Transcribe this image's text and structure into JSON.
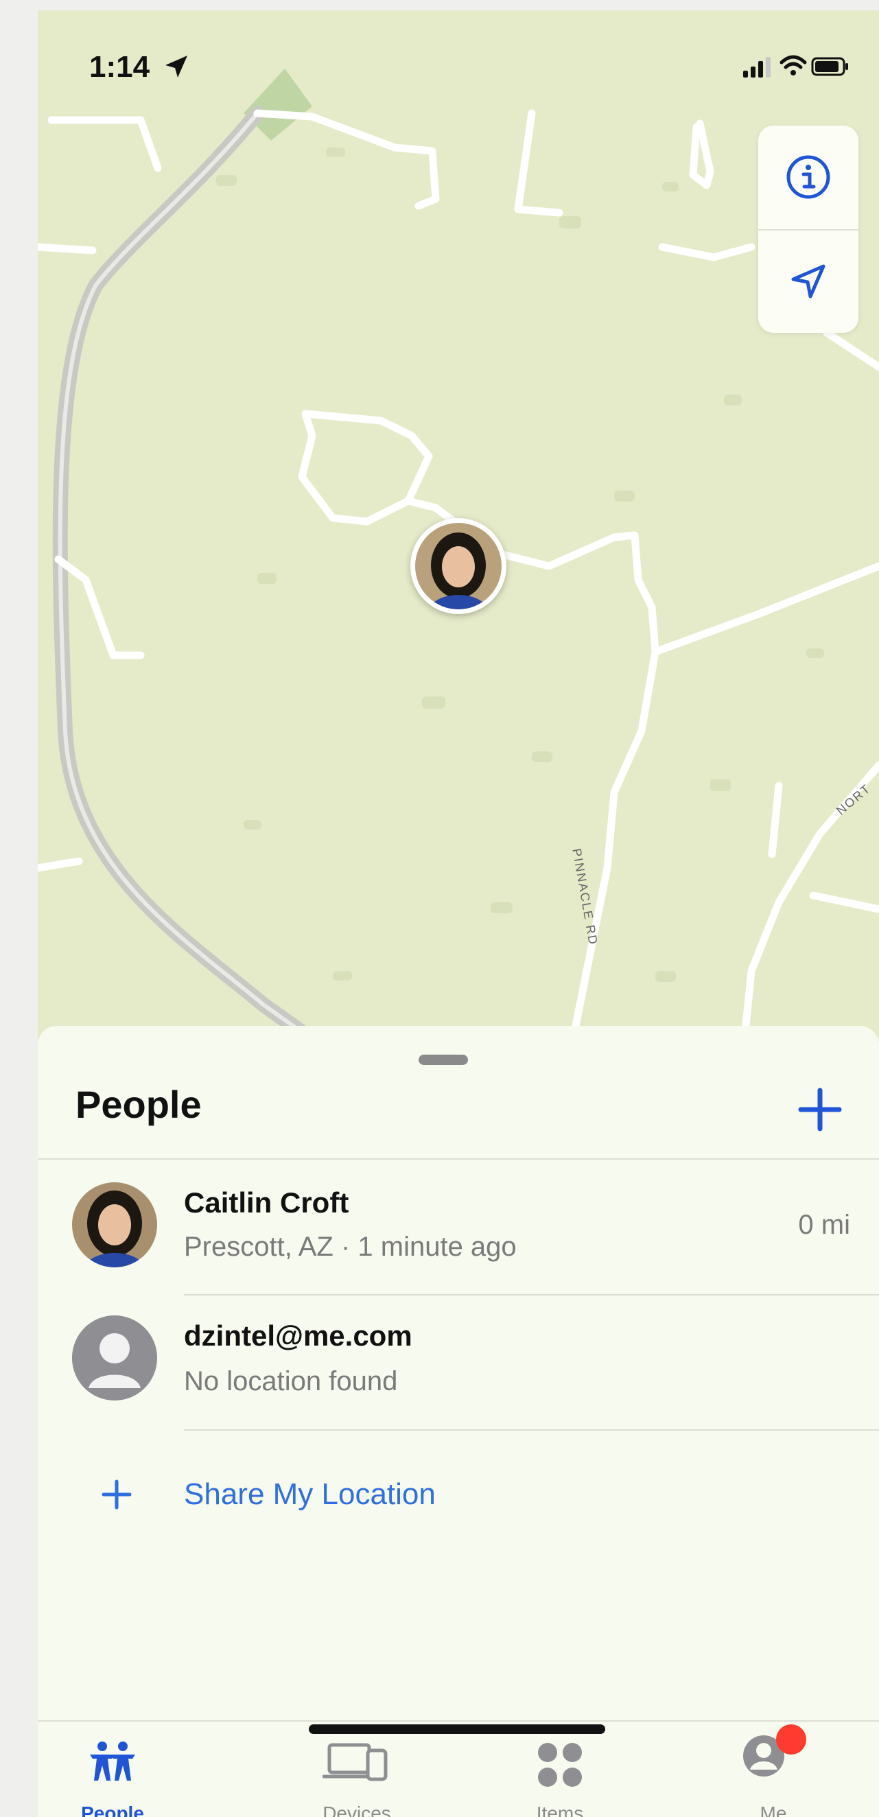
{
  "status_bar": {
    "time": "1:14"
  },
  "map": {
    "road_label_1": "PINNACLE RD",
    "road_label_2": "NORT"
  },
  "sheet": {
    "title": "People"
  },
  "people": [
    {
      "name": "Caitlin Croft",
      "subtitle": "Prescott, AZ · 1 minute ago",
      "distance": "0 mi"
    },
    {
      "name": "dzintel@me.com",
      "subtitle": "No location found",
      "distance": ""
    }
  ],
  "share": {
    "label": "Share My Location"
  },
  "tabs": [
    {
      "label": "People",
      "icon": "people-icon"
    },
    {
      "label": "Devices",
      "icon": "devices-icon"
    },
    {
      "label": "Items",
      "icon": "items-icon"
    },
    {
      "label": "Me",
      "icon": "me-icon"
    }
  ],
  "colors": {
    "accent": "#2F6FE0",
    "map_land": "#E5EBC9",
    "badge": "#FF3B30"
  }
}
